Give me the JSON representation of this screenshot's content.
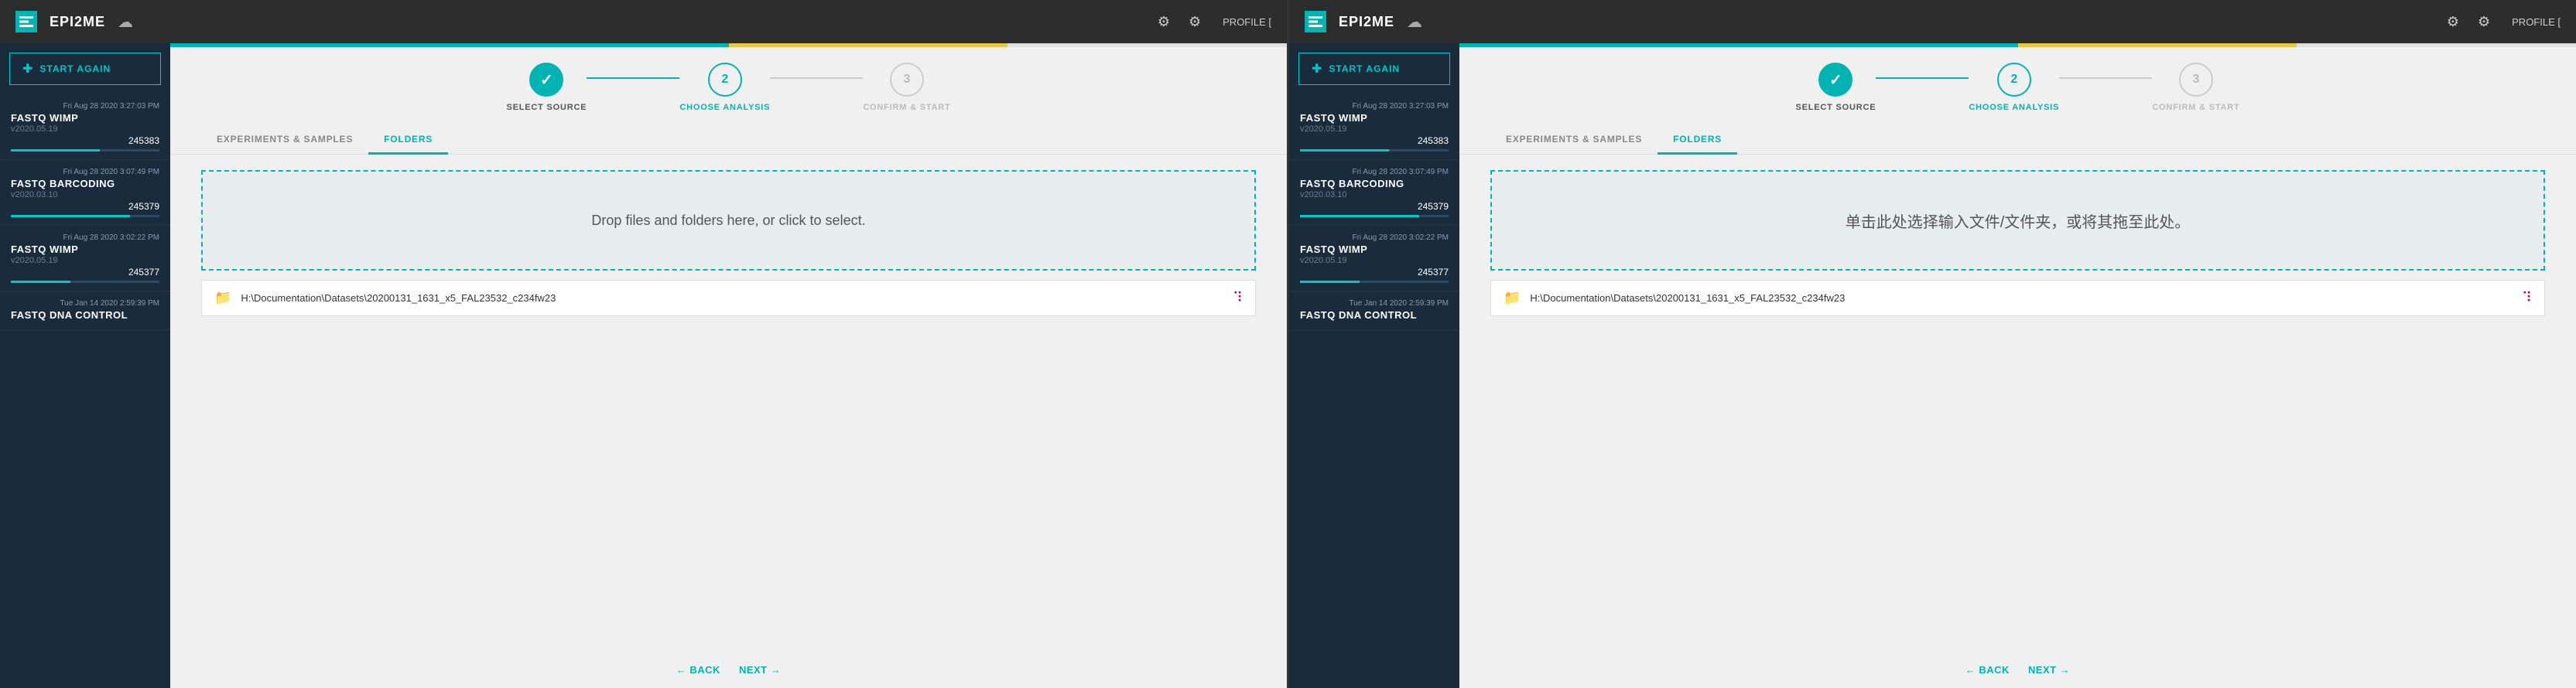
{
  "panels": [
    {
      "id": "panel-left",
      "header": {
        "logo_icon": "≡",
        "logo_text": "EPI2ME",
        "cloud_icon": "☁",
        "settings_icon_1": "⚙",
        "settings_icon_2": "⚙",
        "profile_label": "PROFILE ["
      },
      "sidebar": {
        "start_again_label": "START AGAIN",
        "items": [
          {
            "meta": "Fri Aug 28 2020 3:27:03 PM",
            "name": "FASTQ WIMP",
            "version": "v2020.05.19",
            "id": "245383",
            "bar_pct": 60
          },
          {
            "meta": "Fri Aug 28 2020 3:07:49 PM",
            "name": "FASTQ BARCODING",
            "version": "v2020.03.10",
            "id": "245379",
            "bar_pct": 80
          },
          {
            "meta": "Fri Aug 28 2020 3:02:22 PM",
            "name": "FASTQ WIMP",
            "version": "v2020.05.19",
            "id": "245377",
            "bar_pct": 40
          },
          {
            "meta": "Tue Jan 14 2020 2:59:39 PM",
            "name": "FASTQ DNA CONTROL",
            "version": "",
            "id": "",
            "bar_pct": 0
          }
        ]
      },
      "progress_bar": [
        {
          "color": "#00b4b4",
          "width": "50%"
        },
        {
          "color": "#e8c840",
          "width": "25%"
        },
        {
          "color": "#e0e0e0",
          "width": "25%"
        }
      ],
      "wizard": {
        "steps": [
          {
            "number": "✓",
            "label": "SELECT SOURCE",
            "state": "completed"
          },
          {
            "number": "2",
            "label": "CHOOSE ANALYSIS",
            "state": "active"
          },
          {
            "number": "3",
            "label": "CONFIRM & START",
            "state": "inactive"
          }
        ],
        "connectors": [
          "completed",
          "normal"
        ]
      },
      "tabs": [
        {
          "label": "EXPERIMENTS & SAMPLES",
          "active": false
        },
        {
          "label": "FOLDERS",
          "active": true
        }
      ],
      "drop_zone": {
        "text": "Drop files and folders here, or click to select."
      },
      "file_item": {
        "path": "H:\\Documentation\\Datasets\\20200131_1631_x5_FAL23532_c234fw23"
      },
      "bottom_nav": {
        "back_label": "← BACK",
        "next_label": "NEXT →"
      }
    },
    {
      "id": "panel-right",
      "header": {
        "logo_icon": "≡",
        "logo_text": "EPI2ME",
        "cloud_icon": "☁",
        "settings_icon_1": "⚙",
        "settings_icon_2": "⚙",
        "profile_label": "PROFILE ["
      },
      "sidebar": {
        "start_again_label": "START AGAIN",
        "items": [
          {
            "meta": "Fri Aug 28 2020 3:27:03 PM",
            "name": "FASTQ WIMP",
            "version": "v2020.05.19",
            "id": "245383",
            "bar_pct": 60
          },
          {
            "meta": "Fri Aug 28 2020 3:07:49 PM",
            "name": "FASTQ BARCODING",
            "version": "v2020.03.10",
            "id": "245379",
            "bar_pct": 80
          },
          {
            "meta": "Fri Aug 28 2020 3:02:22 PM",
            "name": "FASTQ WIMP",
            "version": "v2020.05.19",
            "id": "245377",
            "bar_pct": 40
          },
          {
            "meta": "Tue Jan 14 2020 2:59:39 PM",
            "name": "FASTQ DNA CONTROL",
            "version": "",
            "id": "",
            "bar_pct": 0
          }
        ]
      },
      "progress_bar": [
        {
          "color": "#00b4b4",
          "width": "50%"
        },
        {
          "color": "#e8c840",
          "width": "25%"
        },
        {
          "color": "#e0e0e0",
          "width": "25%"
        }
      ],
      "wizard": {
        "steps": [
          {
            "number": "✓",
            "label": "SELECT SOURCE",
            "state": "completed"
          },
          {
            "number": "2",
            "label": "CHOOSE ANALYSIS",
            "state": "active"
          },
          {
            "number": "3",
            "label": "CONFIRM & START",
            "state": "inactive"
          }
        ],
        "connectors": [
          "completed",
          "normal"
        ]
      },
      "tabs": [
        {
          "label": "EXPERIMENTS & SAMPLES",
          "active": false
        },
        {
          "label": "FOLDERS",
          "active": true
        }
      ],
      "drop_zone": {
        "text": "单击此处选择输入文件/文件夹，或将其拖至此处。"
      },
      "file_item": {
        "path": "H:\\Documentation\\Datasets\\20200131_1631_x5_FAL23532_c234fw23"
      },
      "bottom_nav": {
        "back_label": "← BACK",
        "next_label": "NEXT →"
      }
    }
  ]
}
